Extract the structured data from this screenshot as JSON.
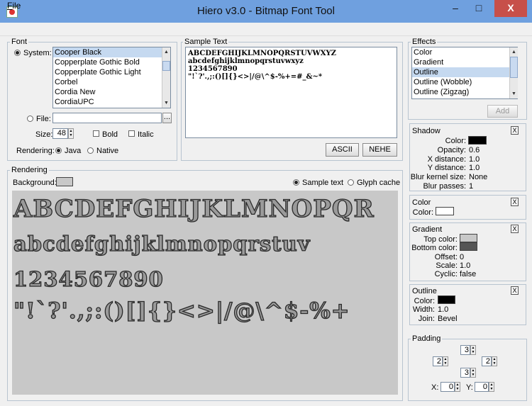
{
  "window": {
    "title": "Hiero v3.0 - Bitmap Font Tool",
    "min_glyph": "–",
    "max_glyph": "□",
    "close_glyph": "X"
  },
  "menu": {
    "file": "File"
  },
  "font": {
    "legend": "Font",
    "system_label": "System:",
    "font_list": [
      "Cooper Black",
      "Copperplate Gothic Bold",
      "Copperplate Gothic Light",
      "Corbel",
      "Cordia New",
      "CordiaUPC"
    ],
    "selected": "Cooper Black",
    "file_label": "File:",
    "file_value": "",
    "browse": "...",
    "size_label": "Size:",
    "size_value": "48",
    "bold_label": "Bold",
    "italic_label": "Italic",
    "rendering_label": "Rendering:",
    "java_label": "Java",
    "native_label": "Native"
  },
  "sample": {
    "legend": "Sample Text",
    "lines": [
      "ABCDEFGHIJKLMNOPQRSTUVWXYZ",
      "abcdefghijklmnopqrstuvwxyz",
      "1234567890",
      "\"!`?'.,;:()[]{}<>|/@\\^$-%+=#_&~*"
    ],
    "ascii_btn": "ASCII",
    "nehe_btn": "NEHE"
  },
  "rendering": {
    "legend": "Rendering",
    "background_label": "Background:",
    "sample_text_label": "Sample text",
    "glyph_cache_label": "Glyph cache",
    "bg_color": "#c8c8c8",
    "lines": [
      "ABCDEFGHIJKLMNOPQR",
      "abcdefghijklmnopqrstuv",
      "1234567890",
      "\"!`?'.,;:()[]{}<>|/@\\^$-%+"
    ]
  },
  "effects": {
    "legend": "Effects",
    "list": [
      "Color",
      "Gradient",
      "Outline",
      "Outline (Wobble)",
      "Outline (Zigzag)"
    ],
    "selected": "Outline",
    "add_btn": "Add"
  },
  "shadow": {
    "title": "Shadow",
    "rows": [
      {
        "label": "Color:",
        "value": ""
      },
      {
        "label": "Opacity:",
        "value": "0.6"
      },
      {
        "label": "X distance:",
        "value": "1.0"
      },
      {
        "label": "Y distance:",
        "value": "1.0"
      },
      {
        "label": "Blur kernel size:",
        "value": "None"
      },
      {
        "label": "Blur passes:",
        "value": "1"
      }
    ],
    "color": "#000000"
  },
  "color_effect": {
    "title": "Color",
    "color_label": "Color:",
    "color": "#ffffff"
  },
  "gradient": {
    "title": "Gradient",
    "top_color_label": "Top color:",
    "bottom_color_label": "Bottom color:",
    "offset_label": "Offset:",
    "offset": "0",
    "scale_label": "Scale:",
    "scale": "1.0",
    "cyclic_label": "Cyclic:",
    "cyclic": "false",
    "top_color": "#c8c8c8",
    "bottom_color": "#555555"
  },
  "outline": {
    "title": "Outline",
    "color_label": "Color:",
    "width_label": "Width:",
    "width": "1.0",
    "join_label": "Join:",
    "join": "Bevel",
    "color": "#000000"
  },
  "padding": {
    "legend": "Padding",
    "top": "3",
    "left": "2",
    "right": "2",
    "bottom": "3",
    "x_label": "X:",
    "x": "0",
    "y_label": "Y:",
    "y": "0"
  },
  "colors": {
    "titlebar": "#6fa0df",
    "selection": "#c5d9f0",
    "close": "#c7504a"
  }
}
